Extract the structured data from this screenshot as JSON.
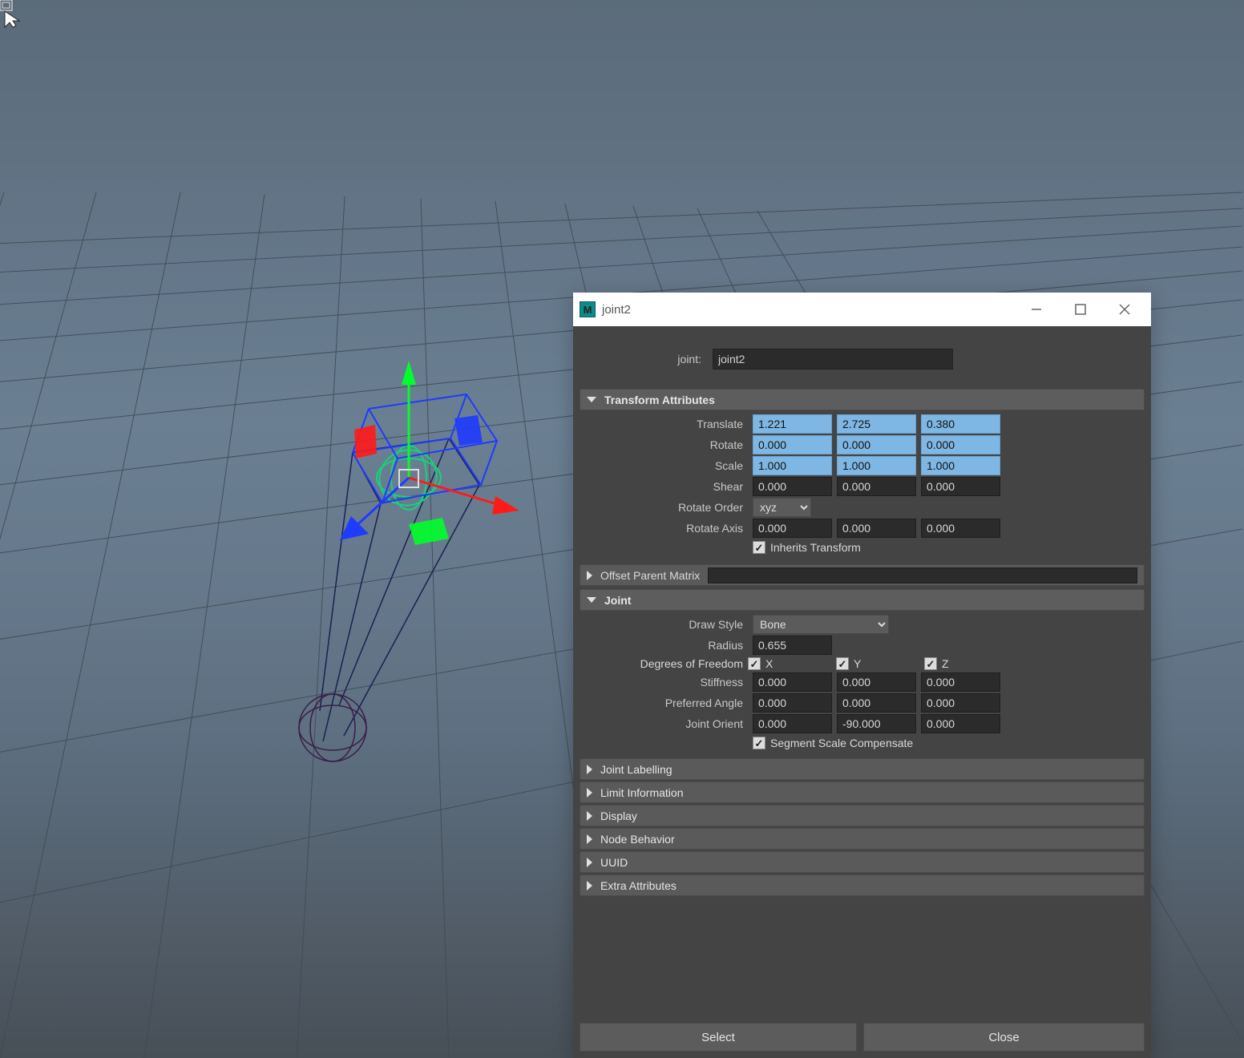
{
  "window": {
    "title": "joint2",
    "app_icon_letter": "M"
  },
  "node": {
    "type_label": "joint:",
    "name": "joint2"
  },
  "sections": {
    "transform": {
      "title": "Transform Attributes",
      "translate_label": "Translate",
      "translate": [
        "1.221",
        "2.725",
        "0.380"
      ],
      "rotate_label": "Rotate",
      "rotate": [
        "0.000",
        "0.000",
        "0.000"
      ],
      "scale_label": "Scale",
      "scale": [
        "1.000",
        "1.000",
        "1.000"
      ],
      "shear_label": "Shear",
      "shear": [
        "0.000",
        "0.000",
        "0.000"
      ],
      "rotate_order_label": "Rotate Order",
      "rotate_order": "xyz",
      "rotate_axis_label": "Rotate Axis",
      "rotate_axis": [
        "0.000",
        "0.000",
        "0.000"
      ],
      "inherits_label": "Inherits Transform",
      "inherits_checked": true,
      "opm_label": "Offset Parent Matrix"
    },
    "joint": {
      "title": "Joint",
      "draw_style_label": "Draw Style",
      "draw_style": "Bone",
      "radius_label": "Radius",
      "radius": "0.655",
      "dof_label": "Degrees of Freedom",
      "dof_x": "X",
      "dof_y": "Y",
      "dof_z": "Z",
      "stiffness_label": "Stiffness",
      "stiffness": [
        "0.000",
        "0.000",
        "0.000"
      ],
      "preferred_angle_label": "Preferred Angle",
      "preferred_angle": [
        "0.000",
        "0.000",
        "0.000"
      ],
      "joint_orient_label": "Joint Orient",
      "joint_orient": [
        "0.000",
        "-90.000",
        "0.000"
      ],
      "ssc_label": "Segment Scale Compensate",
      "ssc_checked": true
    },
    "collapsed": {
      "joint_labelling": "Joint Labelling",
      "limit_information": "Limit Information",
      "display": "Display",
      "node_behavior": "Node Behavior",
      "uuid": "UUID",
      "extra_attributes": "Extra Attributes"
    }
  },
  "buttons": {
    "select": "Select",
    "close": "Close"
  }
}
